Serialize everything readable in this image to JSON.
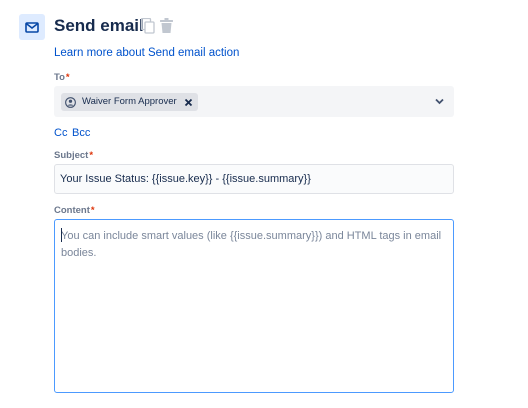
{
  "header": {
    "title": "Send email",
    "icon": "mail-icon",
    "actions": [
      "copy-icon",
      "trash-icon"
    ]
  },
  "learn_more": {
    "text": "Learn more about Send email action"
  },
  "to": {
    "label": "To",
    "required_marker": "*",
    "recipient": {
      "name": "Waiver Form Approver",
      "icon": "user-circle-icon"
    },
    "dropdown_icon": "chevron-down-icon"
  },
  "cc": {
    "text": "Cc"
  },
  "bcc": {
    "text": "Bcc"
  },
  "subject": {
    "label": "Subject",
    "required_marker": "*",
    "value": "Your Issue Status: {{issue.key}} - {{issue.summary}}"
  },
  "content": {
    "label": "Content",
    "required_marker": "*",
    "placeholder": "You can include smart values (like {{issue.summary}}) and HTML tags in email bodies."
  },
  "colors": {
    "accent": "#0052cc",
    "focus_border": "#4c9aff",
    "required": "#de350b",
    "icon_bg": "#deebff"
  }
}
